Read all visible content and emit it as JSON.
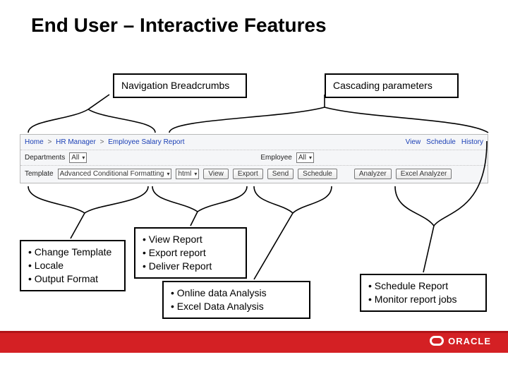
{
  "title": "End User – Interactive Features",
  "callouts": {
    "nav": "Navigation Breadcrumbs",
    "cascading": "Cascading parameters",
    "template": [
      "Change Template",
      "Locale",
      "Output Format"
    ],
    "view": [
      "View Report",
      "Export report",
      "Deliver Report"
    ],
    "analysis": [
      "Online data Analysis",
      "Excel Data Analysis"
    ],
    "schedule": [
      "Schedule Report",
      "Monitor report jobs"
    ]
  },
  "shot": {
    "breadcrumbs": [
      "Home",
      "HR Manager",
      "Employee Salary Report"
    ],
    "toplinks": [
      "View",
      "Schedule",
      "History"
    ],
    "params": {
      "dept_label": "Departments",
      "dept_value": "All",
      "emp_label": "Employee",
      "emp_value": "All"
    },
    "actions": {
      "template_label": "Template",
      "template_value": "Advanced Conditional Formatting",
      "format_value": "html",
      "buttons": [
        "View",
        "Export",
        "Send",
        "Schedule",
        "Analyzer",
        "Excel Analyzer"
      ]
    }
  },
  "footer": {
    "brand": "ORACLE"
  }
}
